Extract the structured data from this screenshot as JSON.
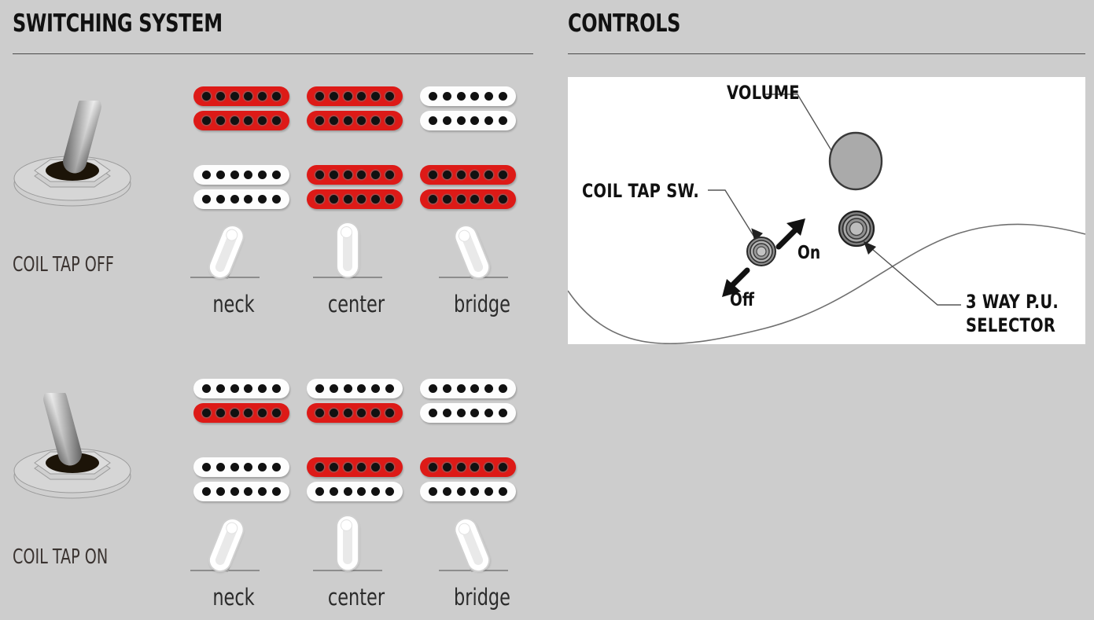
{
  "sections": {
    "switching": {
      "title": "SWITCHING SYSTEM"
    },
    "controls": {
      "title": "CONTROLS"
    }
  },
  "switching": {
    "rows": [
      {
        "id": "coil-tap-off",
        "toggle_label": "COIL TAP OFF",
        "toggle_state": "off",
        "toggle_direction": "right",
        "positions": [
          {
            "name": "neck",
            "lever_angle": "left",
            "pickups": [
              {
                "slot": "neck",
                "coils": [
                  "red",
                  "red"
                ]
              },
              {
                "slot": "bridge",
                "coils": [
                  "white",
                  "white"
                ]
              }
            ]
          },
          {
            "name": "center",
            "lever_angle": "center",
            "pickups": [
              {
                "slot": "neck",
                "coils": [
                  "red",
                  "red"
                ]
              },
              {
                "slot": "bridge",
                "coils": [
                  "red",
                  "red"
                ]
              }
            ]
          },
          {
            "name": "bridge",
            "lever_angle": "right",
            "pickups": [
              {
                "slot": "neck",
                "coils": [
                  "white",
                  "white"
                ]
              },
              {
                "slot": "bridge",
                "coils": [
                  "red",
                  "red"
                ]
              }
            ]
          }
        ]
      },
      {
        "id": "coil-tap-on",
        "toggle_label": "COIL TAP ON",
        "toggle_state": "on",
        "toggle_direction": "left",
        "positions": [
          {
            "name": "neck",
            "lever_angle": "left",
            "pickups": [
              {
                "slot": "neck",
                "coils": [
                  "white",
                  "red"
                ]
              },
              {
                "slot": "bridge",
                "coils": [
                  "white",
                  "white"
                ]
              }
            ]
          },
          {
            "name": "center",
            "lever_angle": "center",
            "pickups": [
              {
                "slot": "neck",
                "coils": [
                  "white",
                  "red"
                ]
              },
              {
                "slot": "bridge",
                "coils": [
                  "red",
                  "white"
                ]
              }
            ]
          },
          {
            "name": "bridge",
            "lever_angle": "right",
            "pickups": [
              {
                "slot": "neck",
                "coils": [
                  "white",
                  "white"
                ]
              },
              {
                "slot": "bridge",
                "coils": [
                  "red",
                  "white"
                ]
              }
            ]
          }
        ]
      }
    ],
    "poles_per_coil": 6
  },
  "controls": {
    "callouts": [
      {
        "id": "volume",
        "label": "VOLUME"
      },
      {
        "id": "coil-tap-sw",
        "label": "COIL TAP SW."
      },
      {
        "id": "selector",
        "label_line1": "3 WAY P.U.",
        "label_line2": "SELECTOR"
      }
    ],
    "switch_directions": [
      {
        "id": "on",
        "label": "On"
      },
      {
        "id": "off",
        "label": "Off"
      }
    ]
  },
  "colors": {
    "background": "#cdcdcd",
    "panel": "#ffffff",
    "coil_active": "#dd1a17",
    "coil_inactive": "#fdfdfd",
    "pole": "#111111",
    "heading": "#111111",
    "rule": "#4a4a4a",
    "knob": "#aaaaaa"
  }
}
